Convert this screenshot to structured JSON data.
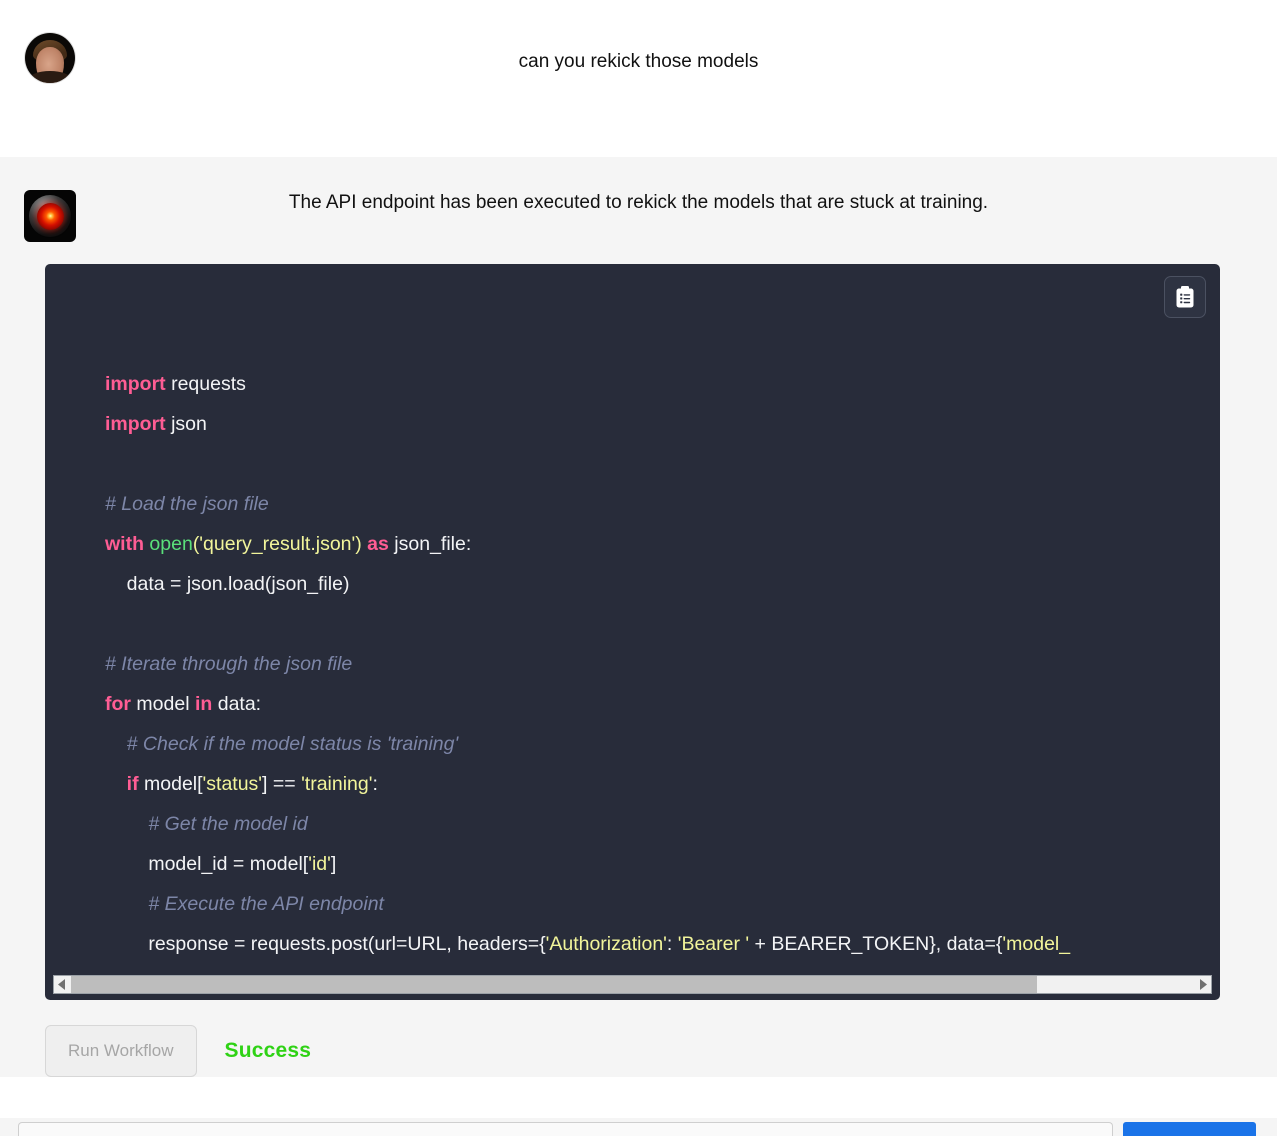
{
  "conversation": {
    "user_message": {
      "avatar_name": "user-avatar",
      "text": "can you rekick those models"
    },
    "assistant_message": {
      "avatar_name": "hal-avatar",
      "text": "The API endpoint has been executed to rekick the models that are stuck at training."
    }
  },
  "code_block": {
    "language": "python",
    "copy_button_label": "Copy code",
    "copy_icon": "clipboard-icon",
    "lines": [
      "import requests",
      "import json",
      "",
      "# Load the json file",
      "with open('query_result.json') as json_file:",
      "    data = json.load(json_file)",
      "",
      "# Iterate through the json file",
      "for model in data:",
      "    # Check if the model status is 'training'",
      "    if model['status'] == 'training':",
      "        # Get the model id",
      "        model_id = model['id']",
      "        # Execute the API endpoint",
      "        response = requests.post(url=URL, headers={'Authorization': 'Bearer ' + BEARER_TOKEN}, data={'model_"
    ],
    "tokens": {
      "import": "import",
      "requests": "requests",
      "json": "json",
      "comment_load": "# Load the json file",
      "with": "with",
      "open": "open",
      "open_arg": "('query_result.json')",
      "as": "as",
      "json_file": "json_file:",
      "data_load": "    data = json.load(json_file)",
      "comment_iterate": "# Iterate through the json file",
      "for": "for",
      "model_in": "model",
      "in": "in",
      "data_colon": "data:",
      "comment_check": "    # Check if the model status is 'training'",
      "if": "if",
      "if_rest_a": "model[",
      "if_str_status": "'status'",
      "if_rest_b": "] == ",
      "if_str_training": "'training'",
      "if_rest_c": ":",
      "comment_getid": "        # Get the model id",
      "model_id_a": "        model_id = model[",
      "model_id_str": "'id'",
      "model_id_b": "]",
      "comment_execute": "        # Execute the API endpoint",
      "resp_a": "        response = requests.post(url=URL, headers={",
      "resp_str_auth": "'Authorization'",
      "resp_b": ": ",
      "resp_str_bearer": "'Bearer '",
      "resp_c": " + BEARER_TOKEN}, data={",
      "resp_str_model": "'model_"
    },
    "scrollbar": {
      "name": "horizontal-scrollbar",
      "thumb_percent": 86,
      "left_arrow": "◀",
      "right_arrow": "▶"
    }
  },
  "controls": {
    "run_workflow_label": "Run Workflow",
    "run_workflow_disabled": true,
    "status_label": "Success",
    "status_color": "#2fd215"
  },
  "composer": {
    "input_value": "",
    "input_placeholder": "",
    "send_label": ""
  },
  "theme": {
    "page_bg": "#ffffff",
    "assistant_bg": "#f5f5f5",
    "code_bg": "#282c3a",
    "keyword_color": "#ff5d94",
    "string_color": "#f2f59b",
    "comment_color": "#7d86a8",
    "function_color": "#5ae07a",
    "accent_blue": "#1a73e8"
  }
}
